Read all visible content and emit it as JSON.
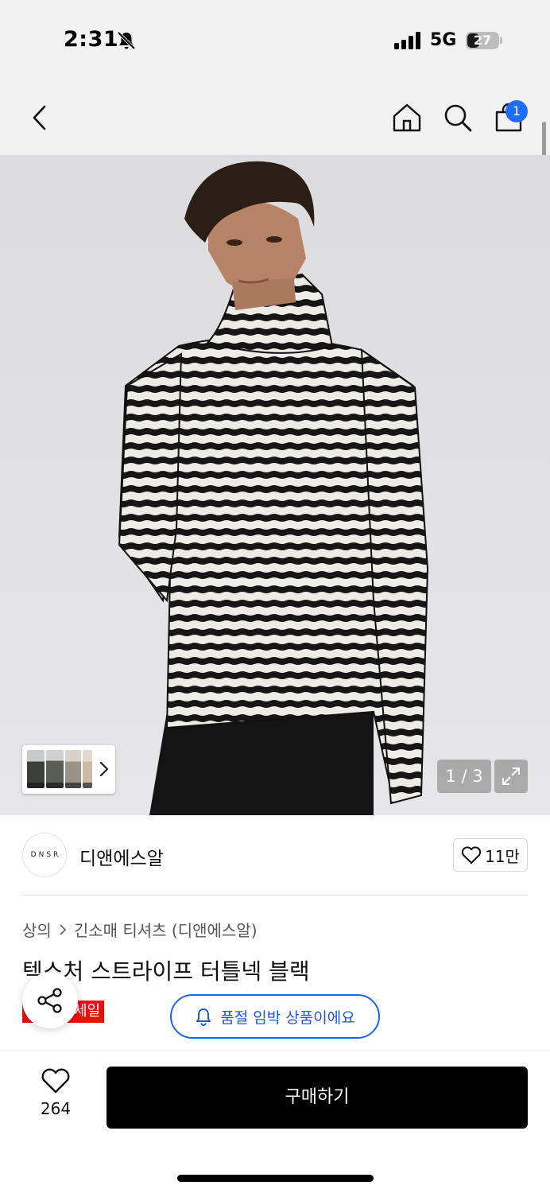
{
  "status_bar": {
    "time": "2:31",
    "network": "5G",
    "battery": "27",
    "icons": [
      "bell-slash-icon",
      "signal-icon",
      "battery-icon"
    ]
  },
  "header": {
    "icons": [
      "back-icon",
      "home-icon",
      "search-icon",
      "cart-icon"
    ],
    "cart_count": "1"
  },
  "gallery": {
    "page_counter": "1 / 3",
    "icons": [
      "chevron-right-icon",
      "expand-icon"
    ]
  },
  "brand": {
    "logo_text": "DNSR",
    "name": "디앤에스알",
    "like_count": "11만"
  },
  "product": {
    "breadcrumb": [
      "상의",
      "긴소매 티셔츠 (디앤에스알)"
    ],
    "title": "텍스처 스트라이프 터틀넥 블랙",
    "sale_badge": "세일"
  },
  "overlay": {
    "soldout_notice": "품절 임박 상품이에요",
    "icons": [
      "share-icon",
      "bell-icon"
    ]
  },
  "bottom_bar": {
    "wish_count": "264",
    "buy_label": "구매하기",
    "icons": [
      "heart-icon"
    ]
  },
  "colors": {
    "accent_blue": "#1f63e8",
    "sale_red": "#e8100f",
    "buy_button": "#000000"
  }
}
